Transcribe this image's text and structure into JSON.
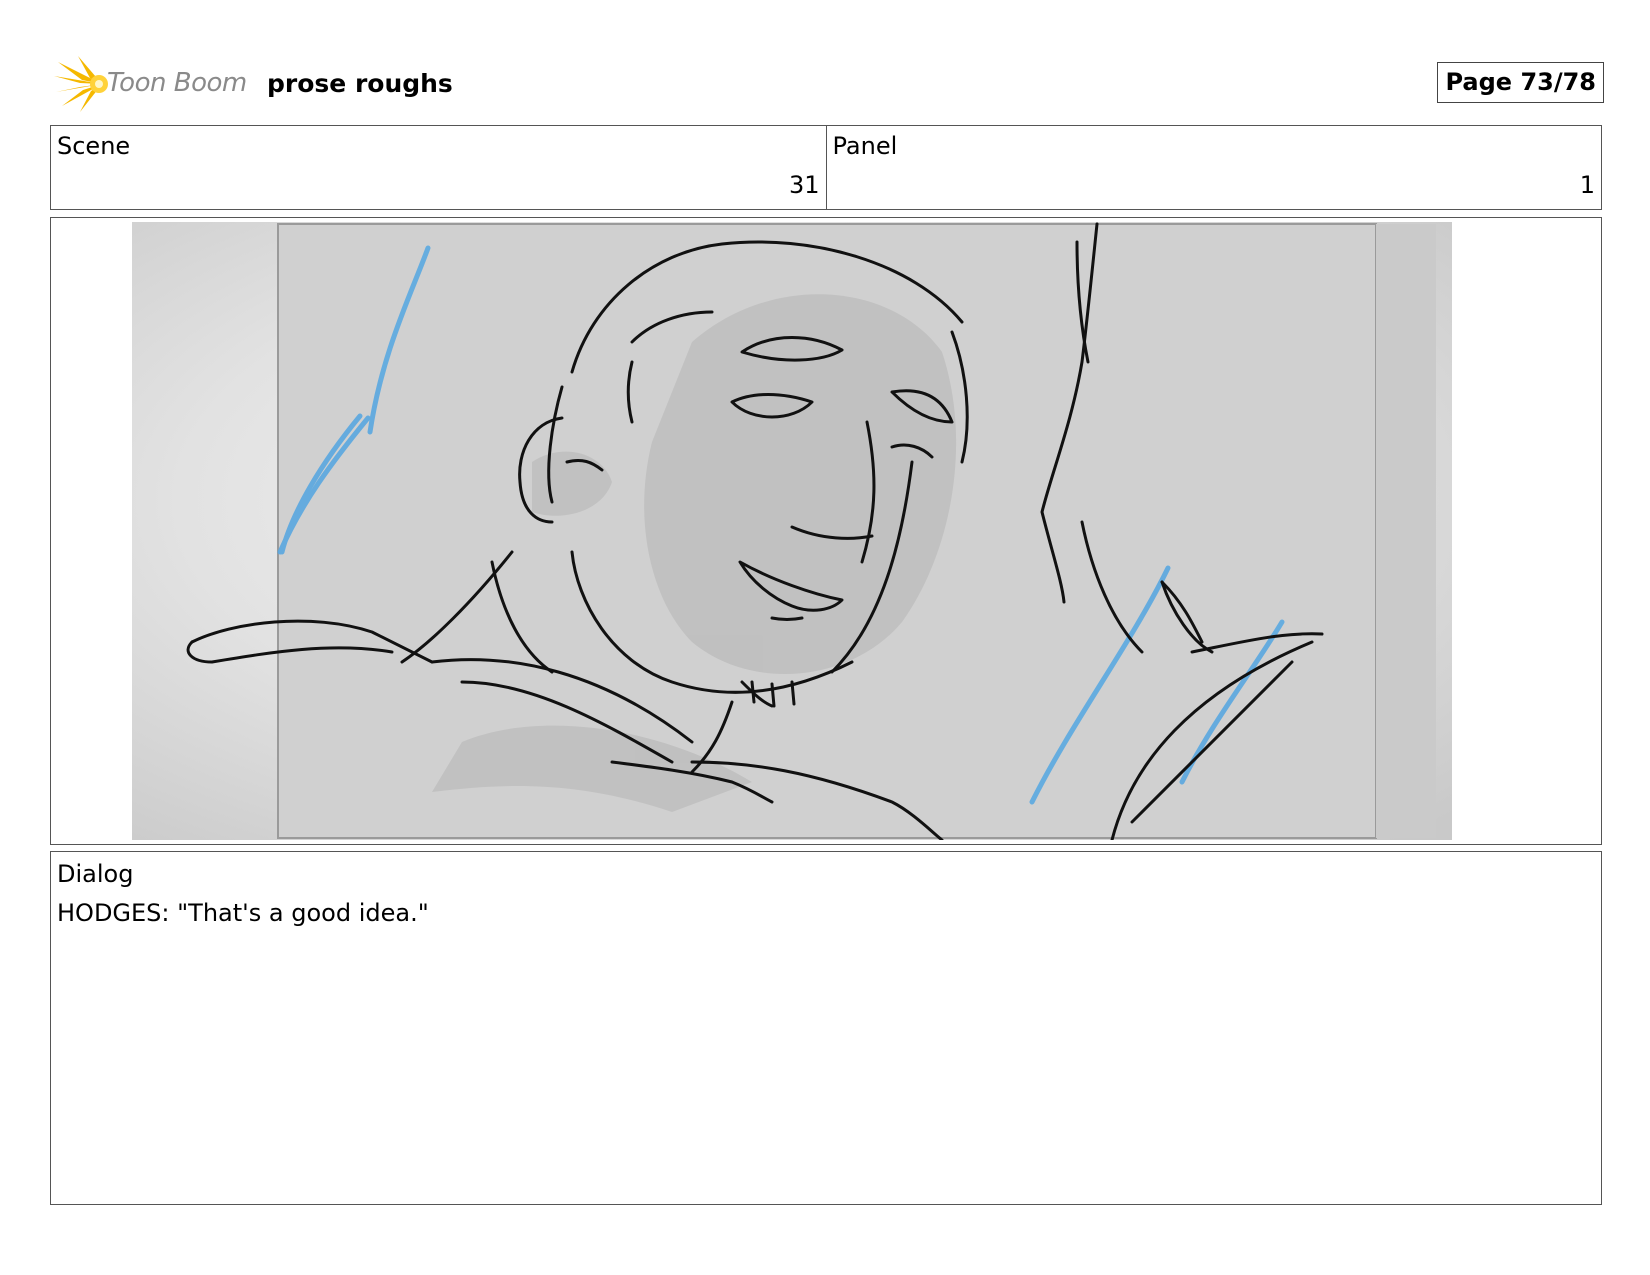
{
  "header": {
    "logo_text": "Toon Boom",
    "project_title": "prose roughs",
    "page_indicator": "Page 73/78"
  },
  "info": {
    "scene_label": "Scene",
    "scene_value": "31",
    "panel_label": "Panel",
    "panel_value": "1"
  },
  "dialog": {
    "label": "Dialog",
    "text": "HODGES: \"That's a good idea.\""
  },
  "colors": {
    "logo_star": "#f5b800",
    "logo_text": "#8a8a8a",
    "sketch_line": "#111111",
    "sketch_blue": "#5aa8e0",
    "sketch_bg": "#d2d2d2"
  }
}
